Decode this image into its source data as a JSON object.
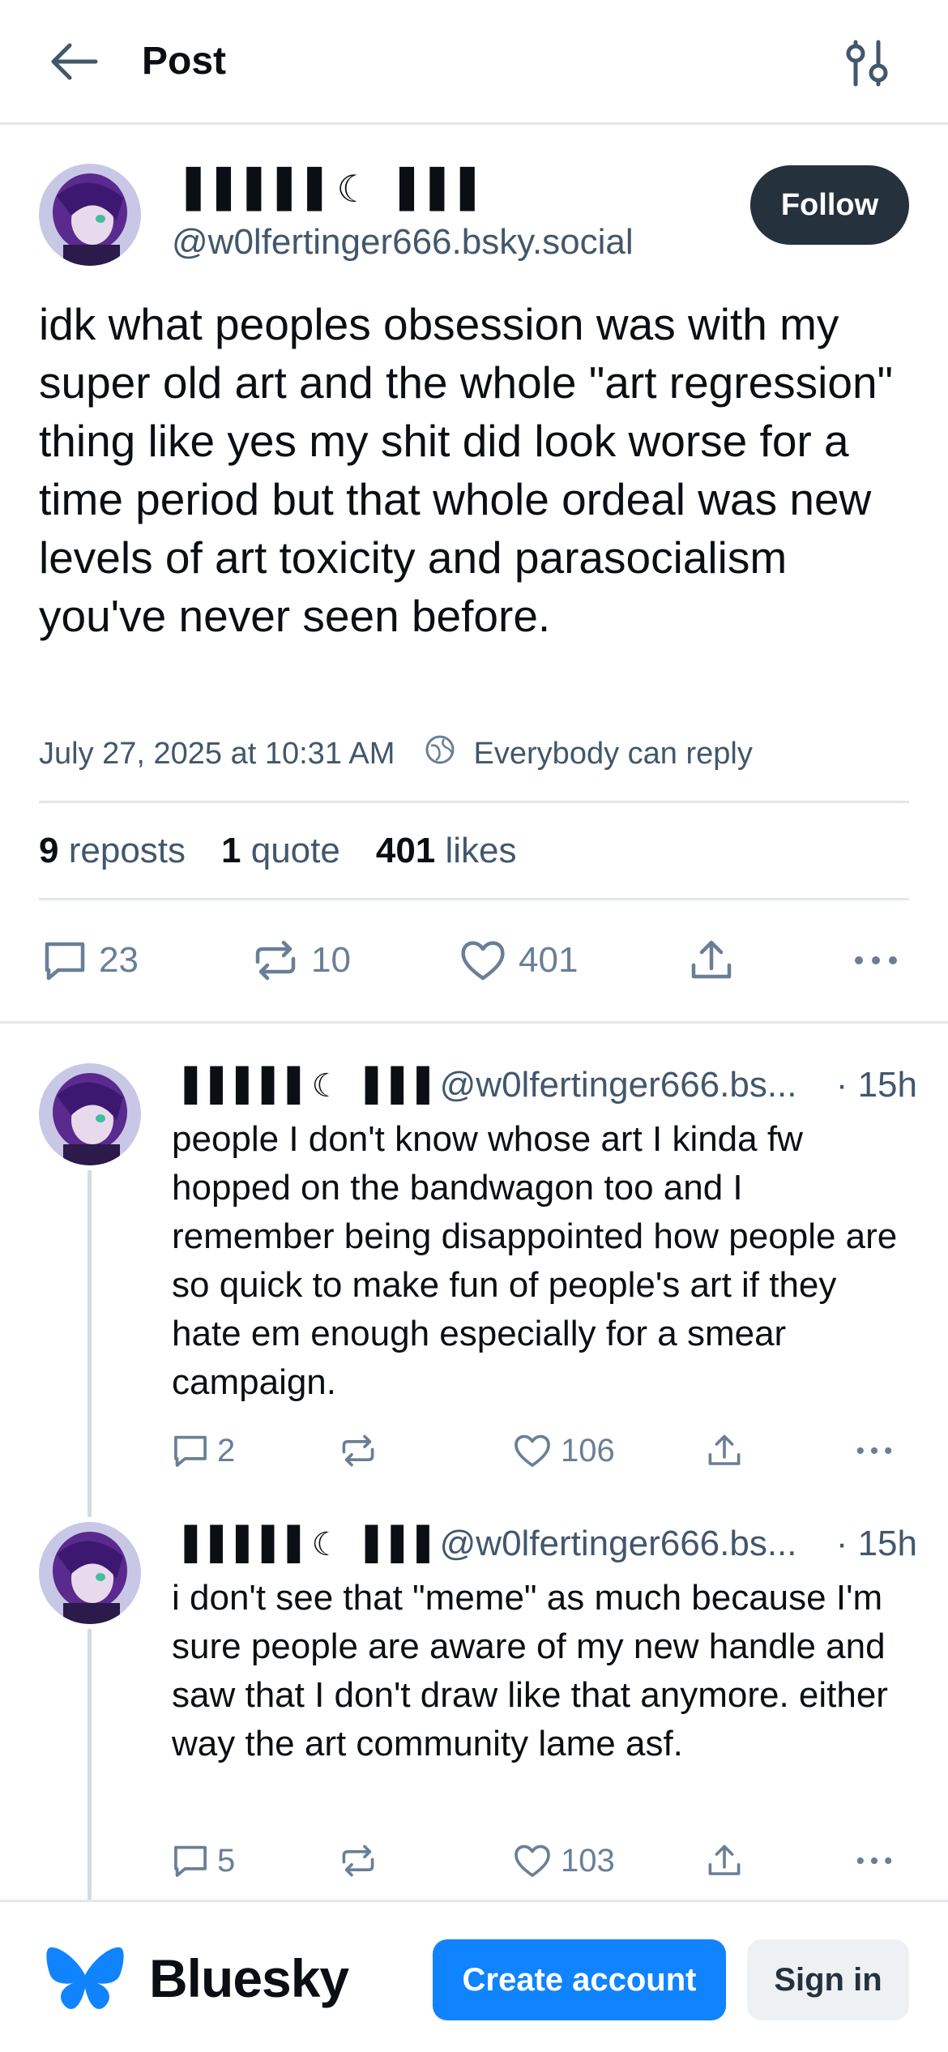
{
  "header": {
    "title": "Post"
  },
  "post": {
    "author": {
      "display_name": "▐▐▐▐▐ ☾ ▐▐▐",
      "handle": "@w0lfertinger666.bsky.social"
    },
    "follow_label": "Follow",
    "text": "idk what peoples obsession was with my super old art and the whole \"art regression\" thing like yes my shit did look worse for a time period but that whole ordeal was new levels of art toxicity and parasocialism you've never seen before.",
    "timestamp": "July 27, 2025 at 10:31 AM",
    "reply_setting": "Everybody can reply",
    "stats": {
      "reposts_count": "9",
      "reposts_label": "reposts",
      "quotes_count": "1",
      "quotes_label": "quote",
      "likes_count": "401",
      "likes_label": "likes"
    },
    "actions": {
      "replies": "23",
      "reposts": "10",
      "likes": "401"
    }
  },
  "replies": [
    {
      "display_name": "▐▐▐▐▐ ☾ ▐▐▐",
      "handle": "@w0lfertinger666.bs...",
      "time": "· 15h",
      "text": "people I don't know whose art I kinda fw hopped on the bandwagon too and I remember being disappointed how people are so quick to make fun of people's art if they hate em enough especially for a smear campaign.",
      "replies": "2",
      "likes": "106"
    },
    {
      "display_name": "▐▐▐▐▐ ☾ ▐▐▐",
      "handle": "@w0lfertinger666.bs...",
      "time": "· 15h",
      "text": "i don't see that \"meme\" as much because I'm sure people are aware of my new handle and saw that I don't draw like that anymore. either way the art community lame asf.",
      "replies": "5",
      "likes": "103"
    }
  ],
  "footer": {
    "brand": "Bluesky",
    "create_account": "Create account",
    "sign_in": "Sign in"
  },
  "colors": {
    "accent": "#1083fe",
    "follow_bg": "#25313d",
    "secondary_text": "#42576c",
    "divider": "#e3e7ec"
  },
  "icons": [
    "back-arrow-icon",
    "settings-sliders-icon",
    "globe-icon",
    "reply-icon",
    "repost-icon",
    "like-icon",
    "share-icon",
    "more-icon",
    "bluesky-butterfly-icon"
  ]
}
